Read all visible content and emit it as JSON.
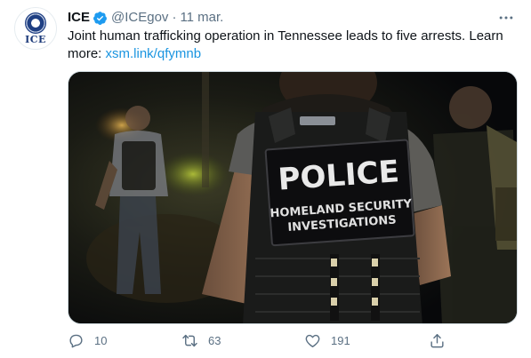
{
  "tweet": {
    "avatar_text": "ICE",
    "author_name": "ICE",
    "handle": "@ICEgov",
    "separator": "·",
    "date": "11 mar.",
    "text_main": "Joint human trafficking operation in Tennessee leads to five arrests. Learn more: ",
    "link": "xsm.link/qfymnb",
    "media": {
      "patch_line1": "POLICE",
      "patch_line2": "HOMELAND SECURITY",
      "patch_line3": "INVESTIGATIONS"
    },
    "actions": {
      "replies": "10",
      "retweets": "63",
      "likes": "191"
    }
  },
  "icons": [
    "verified-badge-icon",
    "more-options-icon",
    "reply-icon",
    "retweet-icon",
    "like-icon",
    "share-icon"
  ],
  "colors": {
    "link": "#1b95e0",
    "secondary_text": "#5b7083",
    "verified": "#1d9bf0"
  }
}
